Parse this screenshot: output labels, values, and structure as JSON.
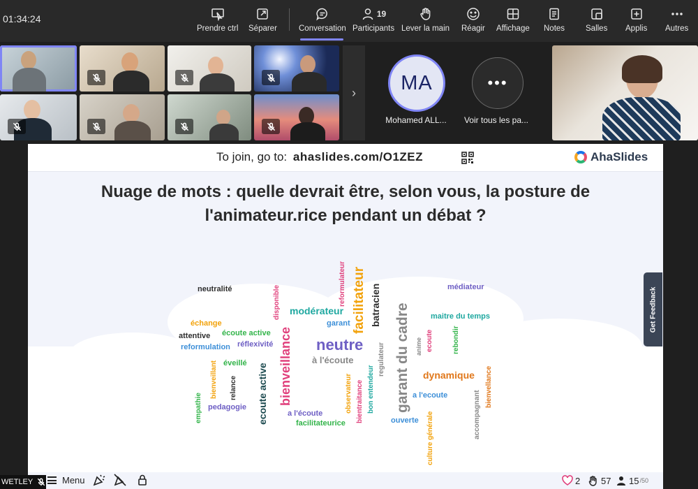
{
  "call": {
    "timer": "01:34:24",
    "toolbar": [
      {
        "key": "take_control",
        "label": "Prendre ctrl",
        "icon": "take-control-icon"
      },
      {
        "key": "pop_out",
        "label": "Séparer",
        "icon": "pop-out-icon"
      },
      {
        "key": "chat",
        "label": "Conversation",
        "icon": "chat-icon"
      },
      {
        "key": "participants",
        "label": "Participants",
        "icon": "participants-icon",
        "count": "19"
      },
      {
        "key": "raise_hand",
        "label": "Lever la main",
        "icon": "raise-hand-icon"
      },
      {
        "key": "react",
        "label": "Réagir",
        "icon": "react-icon"
      },
      {
        "key": "view",
        "label": "Affichage",
        "icon": "view-icon"
      },
      {
        "key": "notes",
        "label": "Notes",
        "icon": "notes-icon"
      },
      {
        "key": "rooms",
        "label": "Salles",
        "icon": "rooms-icon"
      },
      {
        "key": "apps",
        "label": "Applis",
        "icon": "apps-icon"
      },
      {
        "key": "more",
        "label": "Autres",
        "icon": "more-icon"
      }
    ],
    "participants": {
      "avatar_initials": "MA",
      "avatar_name": "Mohamed ALL...",
      "more_label": "Voir tous les pa...",
      "more_glyph": "•••"
    },
    "presenter_name": "WETLEY"
  },
  "slide": {
    "join_prefix": "To join, go to:",
    "join_url": "ahaslides.com/O1ZEZ",
    "brand": "AhaSlides",
    "question": "Nuage de mots : quelle devrait être, selon vous, la posture de l'animateur.rice pendant un débat ?",
    "feedback_label": "Get Feedback",
    "menu_label": "Menu",
    "stats": {
      "hearts": "2",
      "reactions": "57",
      "responses": "15",
      "responses_total": "/50"
    },
    "colors": {
      "purple": "#6e5fc4",
      "orange": "#f2a20b",
      "teal": "#1fa8a0",
      "pink": "#e0407c",
      "green": "#33b44a",
      "blue": "#3d8fd8",
      "gray": "#888888",
      "dark": "#2e2e2e"
    }
  },
  "wordcloud": [
    {
      "text": "neutralité"
    },
    {
      "text": "échange"
    },
    {
      "text": "attentive"
    },
    {
      "text": "écoute active"
    },
    {
      "text": "réflexivité"
    },
    {
      "text": "reformulation"
    },
    {
      "text": "éveillé"
    },
    {
      "text": "disponible"
    },
    {
      "text": "modérateur"
    },
    {
      "text": "garant"
    },
    {
      "text": "reformulateur"
    },
    {
      "text": "facilitateur"
    },
    {
      "text": "batracien"
    },
    {
      "text": "neutre"
    },
    {
      "text": "à l'écoute"
    },
    {
      "text": "bienveillance"
    },
    {
      "text": "regulateur"
    },
    {
      "text": "garant du cadre"
    },
    {
      "text": "médiateur"
    },
    {
      "text": "maitre du temps"
    },
    {
      "text": "anime"
    },
    {
      "text": "ecoute"
    },
    {
      "text": "rebondir"
    },
    {
      "text": "dynamique"
    },
    {
      "text": "bienveillant"
    },
    {
      "text": "relance"
    },
    {
      "text": "ecoute active"
    },
    {
      "text": "empathie"
    },
    {
      "text": "pedagogie"
    },
    {
      "text": "observateur"
    },
    {
      "text": "bientraitance"
    },
    {
      "text": "bon entendeur"
    },
    {
      "text": "a l'écoute"
    },
    {
      "text": "facilitateurice"
    },
    {
      "text": "ouverte"
    },
    {
      "text": "culture générale"
    },
    {
      "text": "accompagnant"
    },
    {
      "text": "a l'ecoute"
    },
    {
      "text": "bienvellance"
    }
  ]
}
